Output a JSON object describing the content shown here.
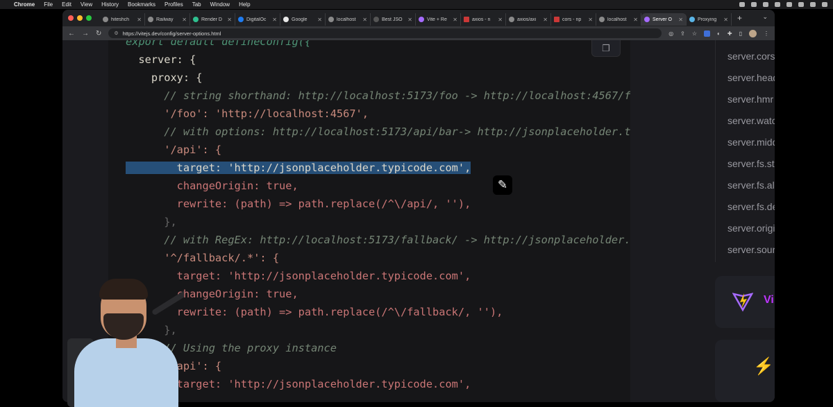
{
  "menubar": {
    "app": "Chrome",
    "items": [
      "File",
      "Edit",
      "View",
      "History",
      "Bookmarks",
      "Profiles",
      "Tab",
      "Window",
      "Help"
    ]
  },
  "browser": {
    "tabs": [
      {
        "label": "hiteshch",
        "icon": "github-icon"
      },
      {
        "label": "Railway",
        "icon": "railway-icon"
      },
      {
        "label": "Render D",
        "icon": "render-icon"
      },
      {
        "label": "DigitalOc",
        "icon": "digitalocean-icon"
      },
      {
        "label": "Google",
        "icon": "google-icon"
      },
      {
        "label": "localhost",
        "icon": "globe-icon"
      },
      {
        "label": "Best JSO",
        "icon": "page-icon"
      },
      {
        "label": "Vite + Re",
        "icon": "vite-icon"
      },
      {
        "label": "axios - n",
        "icon": "npm-icon"
      },
      {
        "label": "axios/axi",
        "icon": "github-icon"
      },
      {
        "label": "cors - np",
        "icon": "npm-icon"
      },
      {
        "label": "localhost",
        "icon": "globe-icon"
      },
      {
        "label": "Server O",
        "icon": "vite-icon",
        "active": true
      },
      {
        "label": "Proxying",
        "icon": "webpack-icon"
      }
    ],
    "new_tab": "+",
    "url": "https://vitejs.dev/config/server-options.html"
  },
  "code_lines": [
    "export default defineConfig({",
    "  server: {",
    "    proxy: {",
    "      // string shorthand: http://localhost:5173/foo -> http://localhost:4567/f",
    "      '/foo': 'http://localhost:4567',",
    "      // with options: http://localhost:5173/api/bar-> http://jsonplaceholder.t",
    "      '/api': {",
    "        target: 'http://jsonplaceholder.typicode.com',",
    "        changeOrigin: true,",
    "        rewrite: (path) => path.replace(/^\\/api/, ''),",
    "      },",
    "      // with RegEx: http://localhost:5173/fallback/ -> http://jsonplaceholder.",
    "      '^/fallback/.*': {",
    "        target: 'http://jsonplaceholder.typicode.com',",
    "        changeOrigin: true,",
    "        rewrite: (path) => path.replace(/^\\/fallback/, ''),",
    "      },",
    "      // Using the proxy instance",
    "      '/api': {",
    "        target: 'http://jsonplaceholder.typicode.com',"
  ],
  "outline": [
    "server.cors",
    "server.headers",
    "server.hmr",
    "server.watch",
    "server.middlewareMode",
    "server.fs.strict",
    "server.fs.allow",
    "server.fs.deny",
    "server.origin",
    "server.sourcemapIgnoreList"
  ],
  "sponsor": {
    "brand": "Vi"
  },
  "colors": {
    "accent": "#bd34fe",
    "selection": "#264f78",
    "code_bg": "#161618"
  }
}
